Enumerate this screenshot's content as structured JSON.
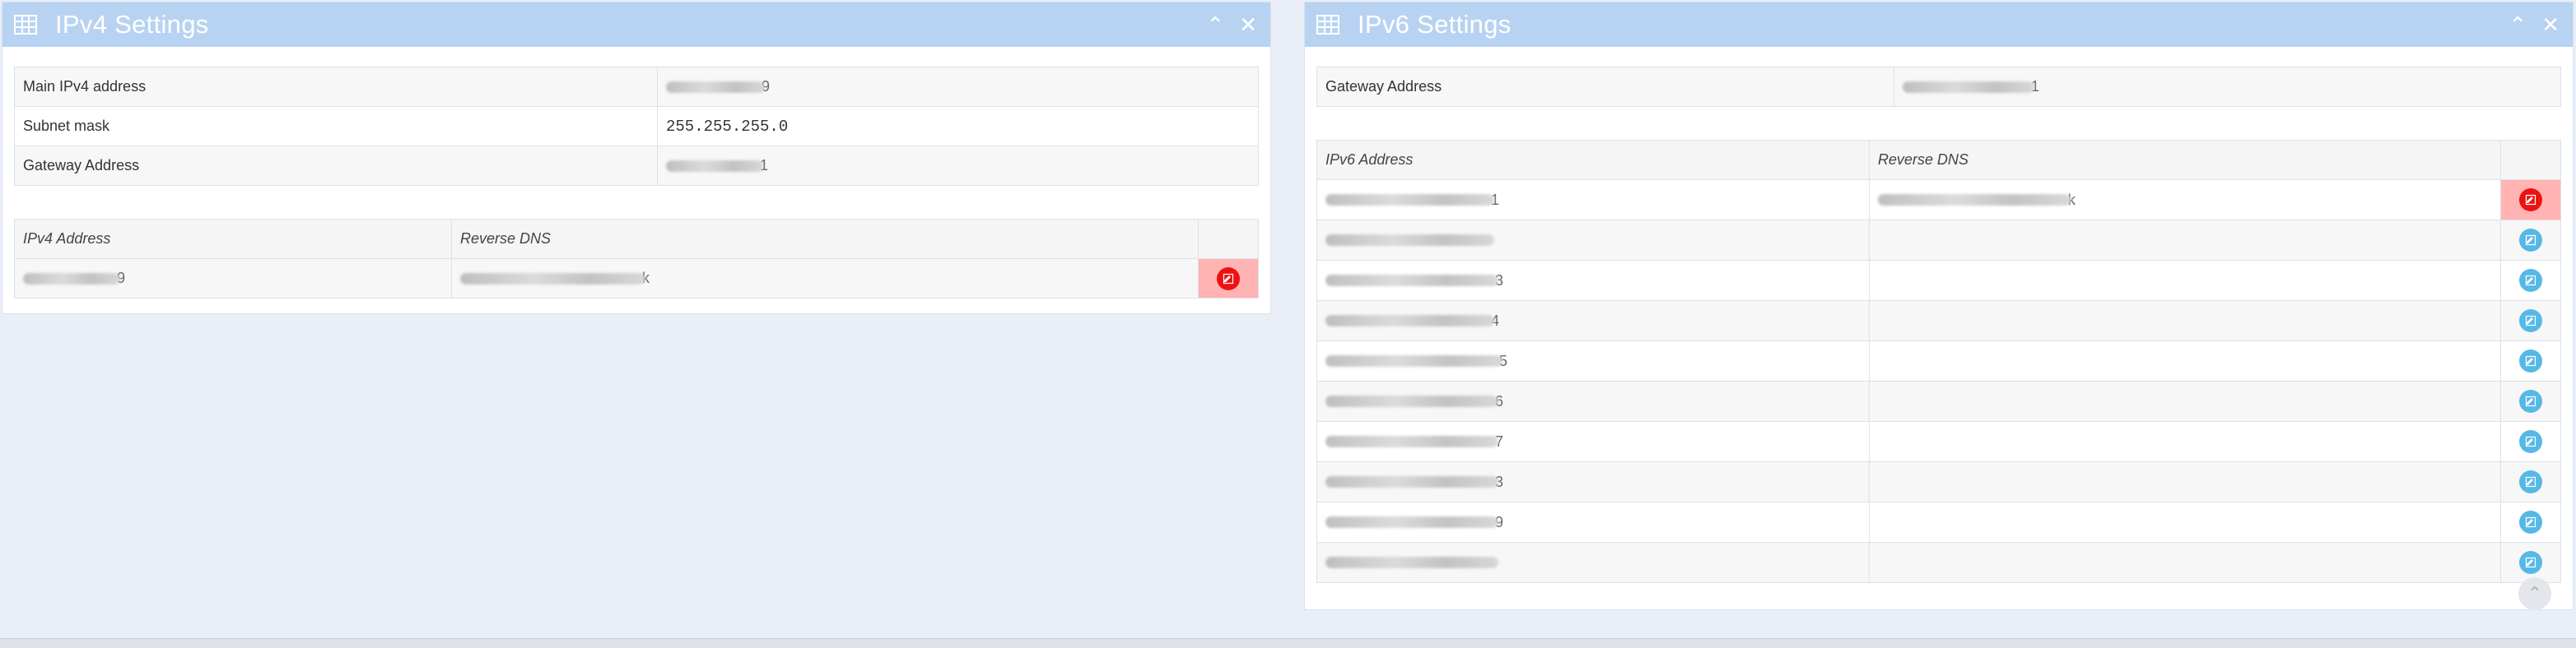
{
  "ipv4": {
    "title": "IPv4 Settings",
    "details": [
      {
        "label": "Main IPv4 address",
        "value_suffix": "9"
      },
      {
        "label": "Subnet mask",
        "value": "255.255.255.0"
      },
      {
        "label": "Gateway Address",
        "value_suffix": "1"
      }
    ],
    "list": {
      "col_address": "IPv4 Address",
      "col_rdns": "Reverse DNS",
      "rows": [
        {
          "address_suffix": "9",
          "rdns_suffix": "k"
        }
      ]
    }
  },
  "ipv6": {
    "title": "IPv6 Settings",
    "gateway": {
      "label": "Gateway Address",
      "value_suffix": "1"
    },
    "list": {
      "col_address": "IPv6 Address",
      "col_rdns": "Reverse DNS",
      "rows": [
        {
          "address_suffix": "1",
          "rdns_suffix": "k",
          "highlight": true
        },
        {
          "address_suffix": "",
          "rdns_suffix": ""
        },
        {
          "address_suffix": "3",
          "rdns_suffix": ""
        },
        {
          "address_suffix": "4",
          "rdns_suffix": ""
        },
        {
          "address_suffix": "5",
          "rdns_suffix": ""
        },
        {
          "address_suffix": "6",
          "rdns_suffix": ""
        },
        {
          "address_suffix": "7",
          "rdns_suffix": ""
        },
        {
          "address_suffix": "3",
          "rdns_suffix": ""
        },
        {
          "address_suffix": "9",
          "rdns_suffix": ""
        },
        {
          "address_suffix": "",
          "rdns_suffix": ""
        }
      ]
    }
  },
  "icons": {
    "panel": "table-icon",
    "collapse": "chevron-up-icon",
    "close": "close-icon",
    "edit": "edit-icon",
    "scroll_top": "chevron-up-icon"
  },
  "colors": {
    "header": "#b8d3f1",
    "danger_cell": "#ffb3b3",
    "edit_red": "#ee1111",
    "edit_blue": "#56b8e6"
  }
}
